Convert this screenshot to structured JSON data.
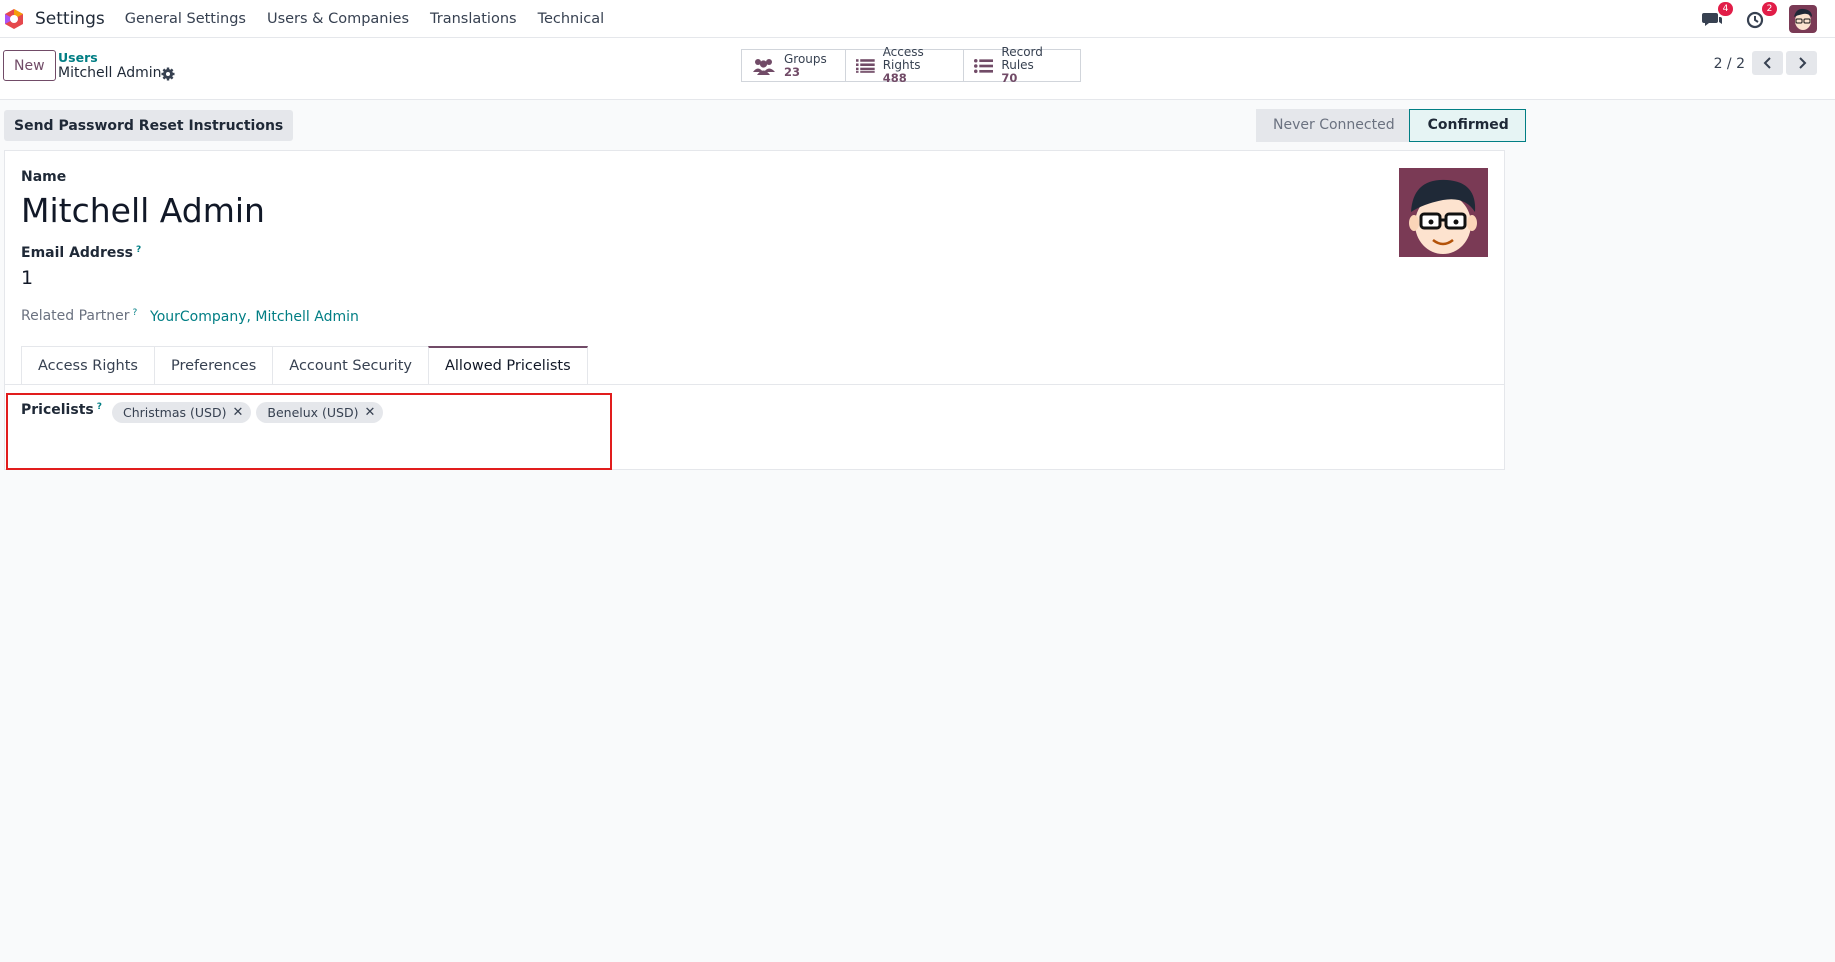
{
  "navbar": {
    "app_name": "Settings",
    "menus": [
      "General Settings",
      "Users & Companies",
      "Translations",
      "Technical"
    ],
    "messages_badge": "4",
    "activities_badge": "2"
  },
  "control_panel": {
    "new_label": "New",
    "breadcrumb_parent": "Users",
    "breadcrumb_current": "Mitchell Admin",
    "smart_buttons": [
      {
        "label": "Groups",
        "count": "23",
        "icon": "users-icon"
      },
      {
        "label": "Access Rights",
        "count": "488",
        "icon": "list-icon"
      },
      {
        "label": "Record Rules",
        "count": "70",
        "icon": "list-icon"
      }
    ],
    "pager": "2 / 2"
  },
  "actions": {
    "reset_label": "Send Password Reset Instructions"
  },
  "statusbar": {
    "steps": [
      "Never Connected",
      "Confirmed"
    ],
    "active": "Confirmed"
  },
  "form": {
    "name_label": "Name",
    "name_value": "Mitchell Admin",
    "email_label": "Email Address",
    "help_mark": "?",
    "email_value": "1",
    "partner_label": "Related Partner",
    "partner_value": "YourCompany, Mitchell Admin",
    "tabs": [
      "Access Rights",
      "Preferences",
      "Account Security",
      "Allowed Pricelists"
    ],
    "active_tab": "Allowed Pricelists",
    "pricelists_label": "Pricelists",
    "pricelists": [
      "Christmas (USD)",
      "Benelux (USD)"
    ],
    "tag_remove": "✕"
  },
  "colors": {
    "brand": "#714b67",
    "accent": "#017e84",
    "highlight": "#e11d1d"
  }
}
